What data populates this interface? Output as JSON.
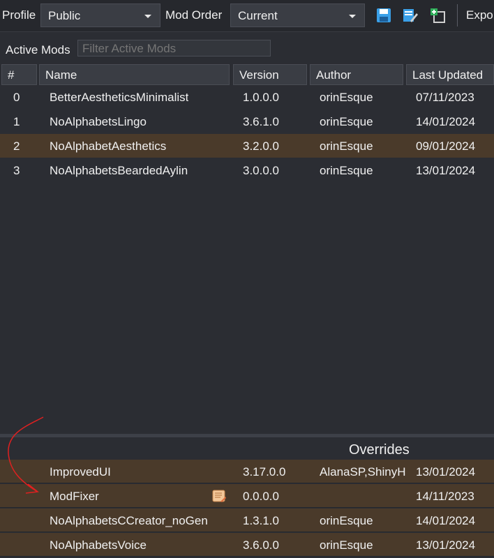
{
  "toolbar": {
    "profile_label": "Profile",
    "profile_value": "Public",
    "mod_order_label": "Mod Order",
    "mod_order_value": "Current",
    "export_label": "Expo",
    "icons": [
      "save-icon",
      "edit-icon",
      "copy-add-icon"
    ]
  },
  "active_mods": {
    "label": "Active Mods",
    "filter_placeholder": "Filter Active Mods"
  },
  "columns": [
    "#",
    "Name",
    "Version",
    "Author",
    "Last Updated"
  ],
  "rows": [
    {
      "index": "0",
      "name": "BetterAestheticsMinimalist",
      "version": "1.0.0.0",
      "author": "orinEsque",
      "updated": "07/11/2023",
      "highlight": false
    },
    {
      "index": "1",
      "name": "NoAlphabetsLingo",
      "version": "3.6.1.0",
      "author": "orinEsque",
      "updated": "14/01/2024",
      "highlight": false
    },
    {
      "index": "2",
      "name": "NoAlphabetAesthetics",
      "version": "3.2.0.0",
      "author": "orinEsque",
      "updated": "09/01/2024",
      "highlight": true
    },
    {
      "index": "3",
      "name": "NoAlphabetsBeardedAylin",
      "version": "3.0.0.0",
      "author": "orinEsque",
      "updated": "13/01/2024",
      "highlight": false
    }
  ],
  "overrides": {
    "title": "Overrides",
    "rows": [
      {
        "name": "ImprovedUI",
        "version": "3.17.0.0",
        "author": "AlanaSP,ShinyH",
        "updated": "13/01/2024"
      },
      {
        "name": "ModFixer",
        "version": "0.0.0.0",
        "author": "",
        "updated": "14/11/2023",
        "icon": "scroll-icon"
      },
      {
        "name": "NoAlphabetsCCreator_noGen",
        "version": "1.3.1.0",
        "author": "orinEsque",
        "updated": "14/01/2024"
      },
      {
        "name": "NoAlphabetsVoice",
        "version": "3.6.0.0",
        "author": "orinEsque",
        "updated": "13/01/2024"
      }
    ]
  },
  "colors": {
    "background": "#2b2d33",
    "highlight_row": "#4a3a2a",
    "icon_blue": "#3aa0e8",
    "annotation": "#e02020"
  }
}
